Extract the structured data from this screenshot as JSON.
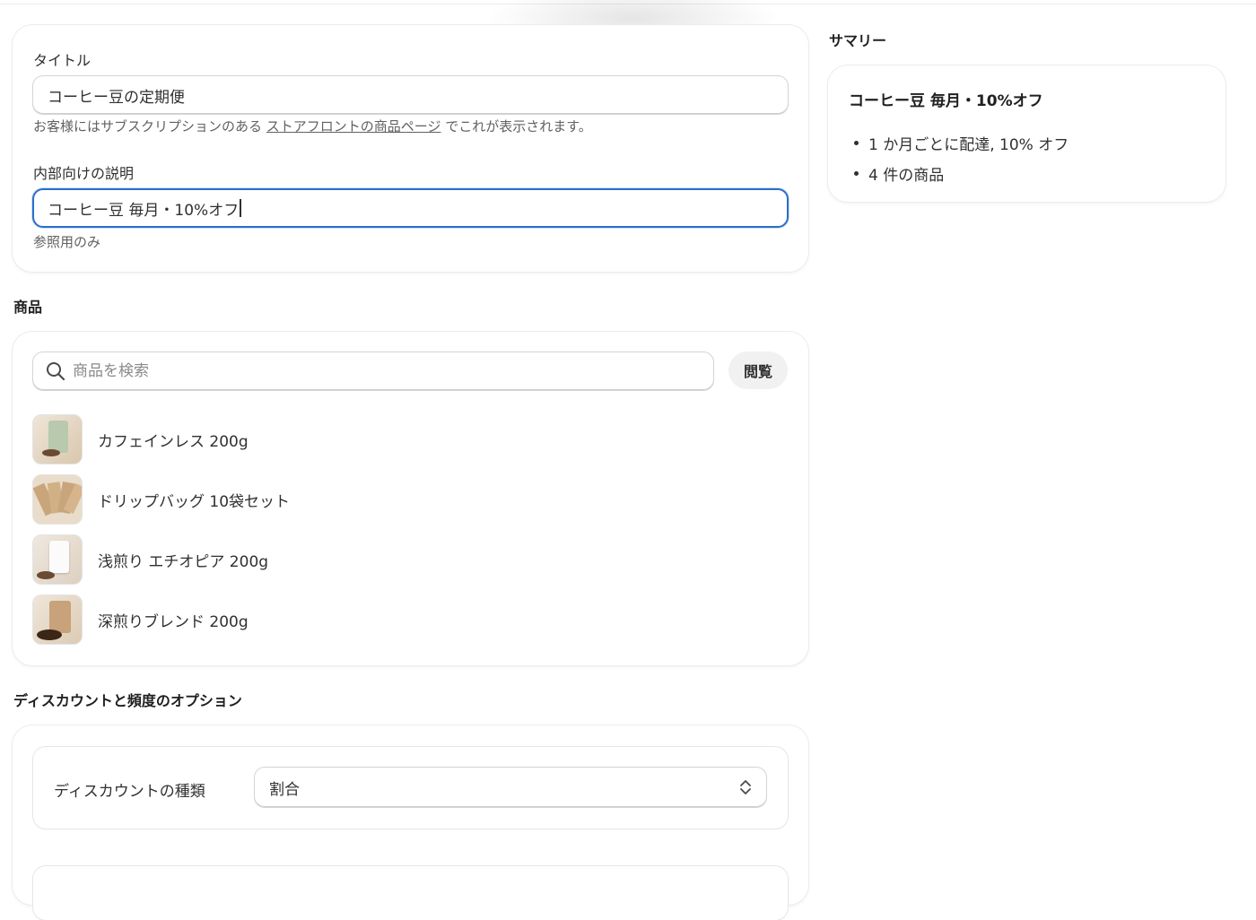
{
  "title_field": {
    "label": "タイトル",
    "value": "コーヒー豆の定期便",
    "help_prefix": "お客様にはサブスクリプションのある",
    "help_link": "ストアフロントの商品ページ",
    "help_suffix": "でこれが表示されます。"
  },
  "internal_field": {
    "label": "内部向けの説明",
    "value": "コーヒー豆 毎月・10%オフ",
    "help": "参照用のみ"
  },
  "products": {
    "heading": "商品",
    "search_placeholder": "商品を検索",
    "browse_label": "閲覧",
    "items": [
      {
        "name": "カフェインレス 200g",
        "thumb": "decaf-bag"
      },
      {
        "name": "ドリップバッグ 10袋セット",
        "thumb": "drip-bags"
      },
      {
        "name": "浅煎り エチオピア 200g",
        "thumb": "white-bag"
      },
      {
        "name": "深煎りブレンド 200g",
        "thumb": "kraft-bag"
      }
    ]
  },
  "discount": {
    "heading": "ディスカウントと頻度のオプション",
    "type_label": "ディスカウントの種類",
    "type_value": "割合"
  },
  "summary": {
    "heading": "サマリー",
    "title": "コーヒー豆 毎月・10%オフ",
    "lines": [
      "1 か月ごとに配達, 10% オフ",
      "4 件の商品"
    ]
  }
}
